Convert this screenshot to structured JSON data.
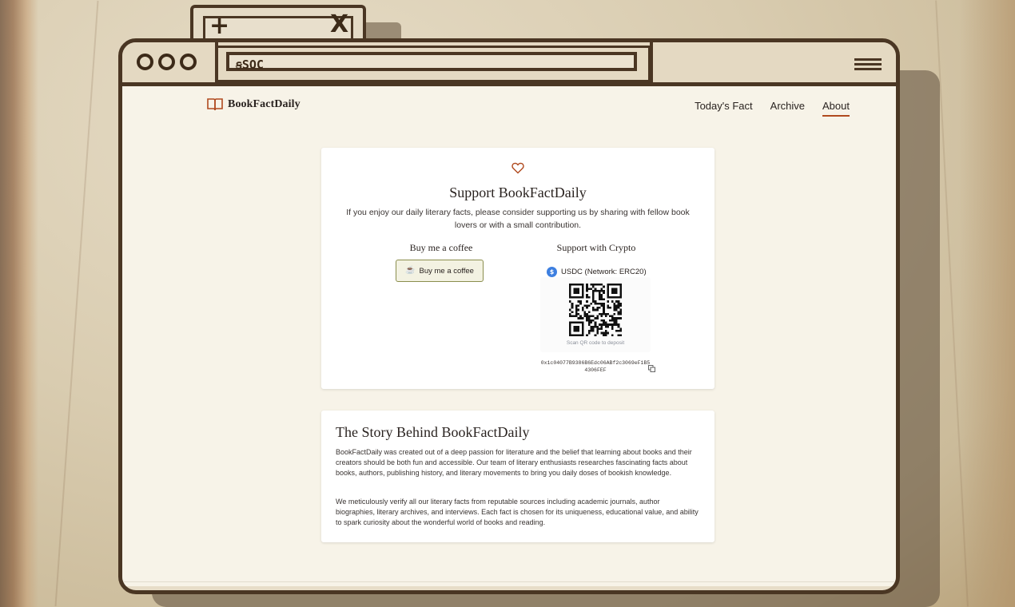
{
  "browser": {
    "address": "ꞩSOC",
    "tab_plus": "+",
    "tab_close": "X"
  },
  "site": {
    "logo_text": "BookFactDaily",
    "nav": [
      "Today's Fact",
      "Archive",
      "About"
    ],
    "active_nav": "About"
  },
  "support": {
    "title": "Support BookFactDaily",
    "description": "If you enjoy our daily literary facts, please consider supporting us by sharing with fellow book lovers or with a small contribution.",
    "coffee_heading": "Buy me a coffee",
    "coffee_button": "Buy me a coffee",
    "crypto_heading": "Support with Crypto",
    "crypto_coin_symbol": "$",
    "crypto_network": "USDC (Network: ERC20)",
    "qr_caption": "Scan QR code to deposit",
    "wallet_address": "0x1c04077B9386B6Edc06ABf2c3069eF1B54306FEF"
  },
  "story": {
    "title": "The Story Behind BookFactDaily",
    "paragraph1": "BookFactDaily was created out of a deep passion for literature and the belief that learning about books and their creators should be both fun and accessible. Our team of literary enthusiasts researches fascinating facts about books, authors, publishing history, and literary movements to bring you daily doses of bookish knowledge.",
    "paragraph2": "We meticulously verify all our literary facts from reputable sources including academic journals, author biographies, literary archives, and interviews. Each fact is chosen for its uniqueness, educational value, and ability to spark curiosity about the wonderful world of books and reading."
  },
  "colors": {
    "accent": "#b04a1f",
    "frame": "#4a3623",
    "page_bg": "#f7f3e8",
    "coin": "#3d7fe0"
  }
}
